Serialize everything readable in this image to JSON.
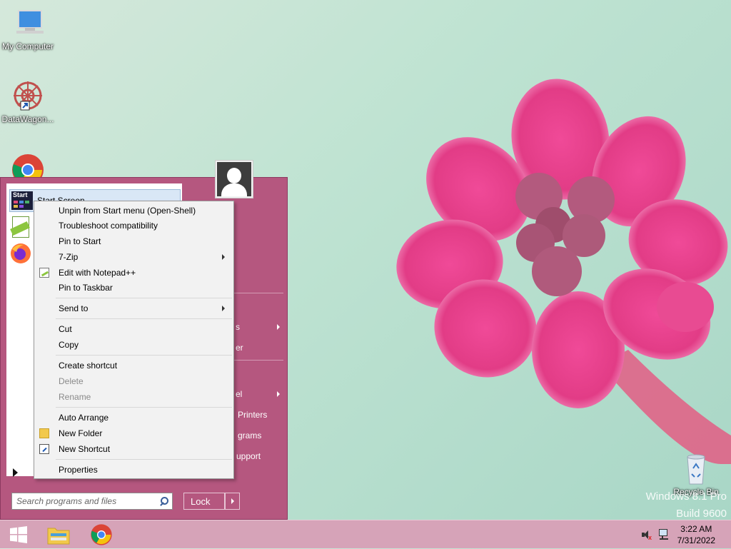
{
  "desktop": {
    "icons": [
      {
        "label": "My Computer"
      },
      {
        "label": "DataWagon..."
      },
      {
        "label": "Recycle Bin"
      }
    ],
    "watermark": {
      "line1": "Windows 8.1 Pro",
      "line2": "Build 9600"
    }
  },
  "start_menu": {
    "pinned": [
      {
        "label": "Start Screen",
        "badge": "Start"
      },
      {
        "label": ""
      },
      {
        "label": ""
      }
    ],
    "right_items": [
      "s",
      "er",
      "el",
      "Printers",
      "grams",
      "upport"
    ],
    "search": {
      "placeholder": "Search programs and files"
    },
    "lock_label": "Lock"
  },
  "context_menu": {
    "items": [
      {
        "label": "Unpin from Start menu (Open-Shell)"
      },
      {
        "label": "Troubleshoot compatibility"
      },
      {
        "label": "Pin to Start"
      },
      {
        "label": "7-Zip"
      },
      {
        "label": "Edit with Notepad++"
      },
      {
        "label": "Pin to Taskbar"
      },
      {
        "label": "Send to"
      },
      {
        "label": "Cut"
      },
      {
        "label": "Copy"
      },
      {
        "label": "Create shortcut"
      },
      {
        "label": "Delete"
      },
      {
        "label": "Rename"
      },
      {
        "label": "Auto Arrange"
      },
      {
        "label": "New Folder"
      },
      {
        "label": "New Shortcut"
      },
      {
        "label": "Properties"
      }
    ]
  },
  "taskbar": {
    "clock_time": "3:22 AM",
    "clock_date": "7/31/2022",
    "tray": [
      "volume-muted-icon",
      "network-icon"
    ]
  },
  "colors": {
    "start_menu_bg": "#b5577f",
    "taskbar_bg": "#d6a3b8",
    "context_menu_bg": "#f2f2f2"
  }
}
